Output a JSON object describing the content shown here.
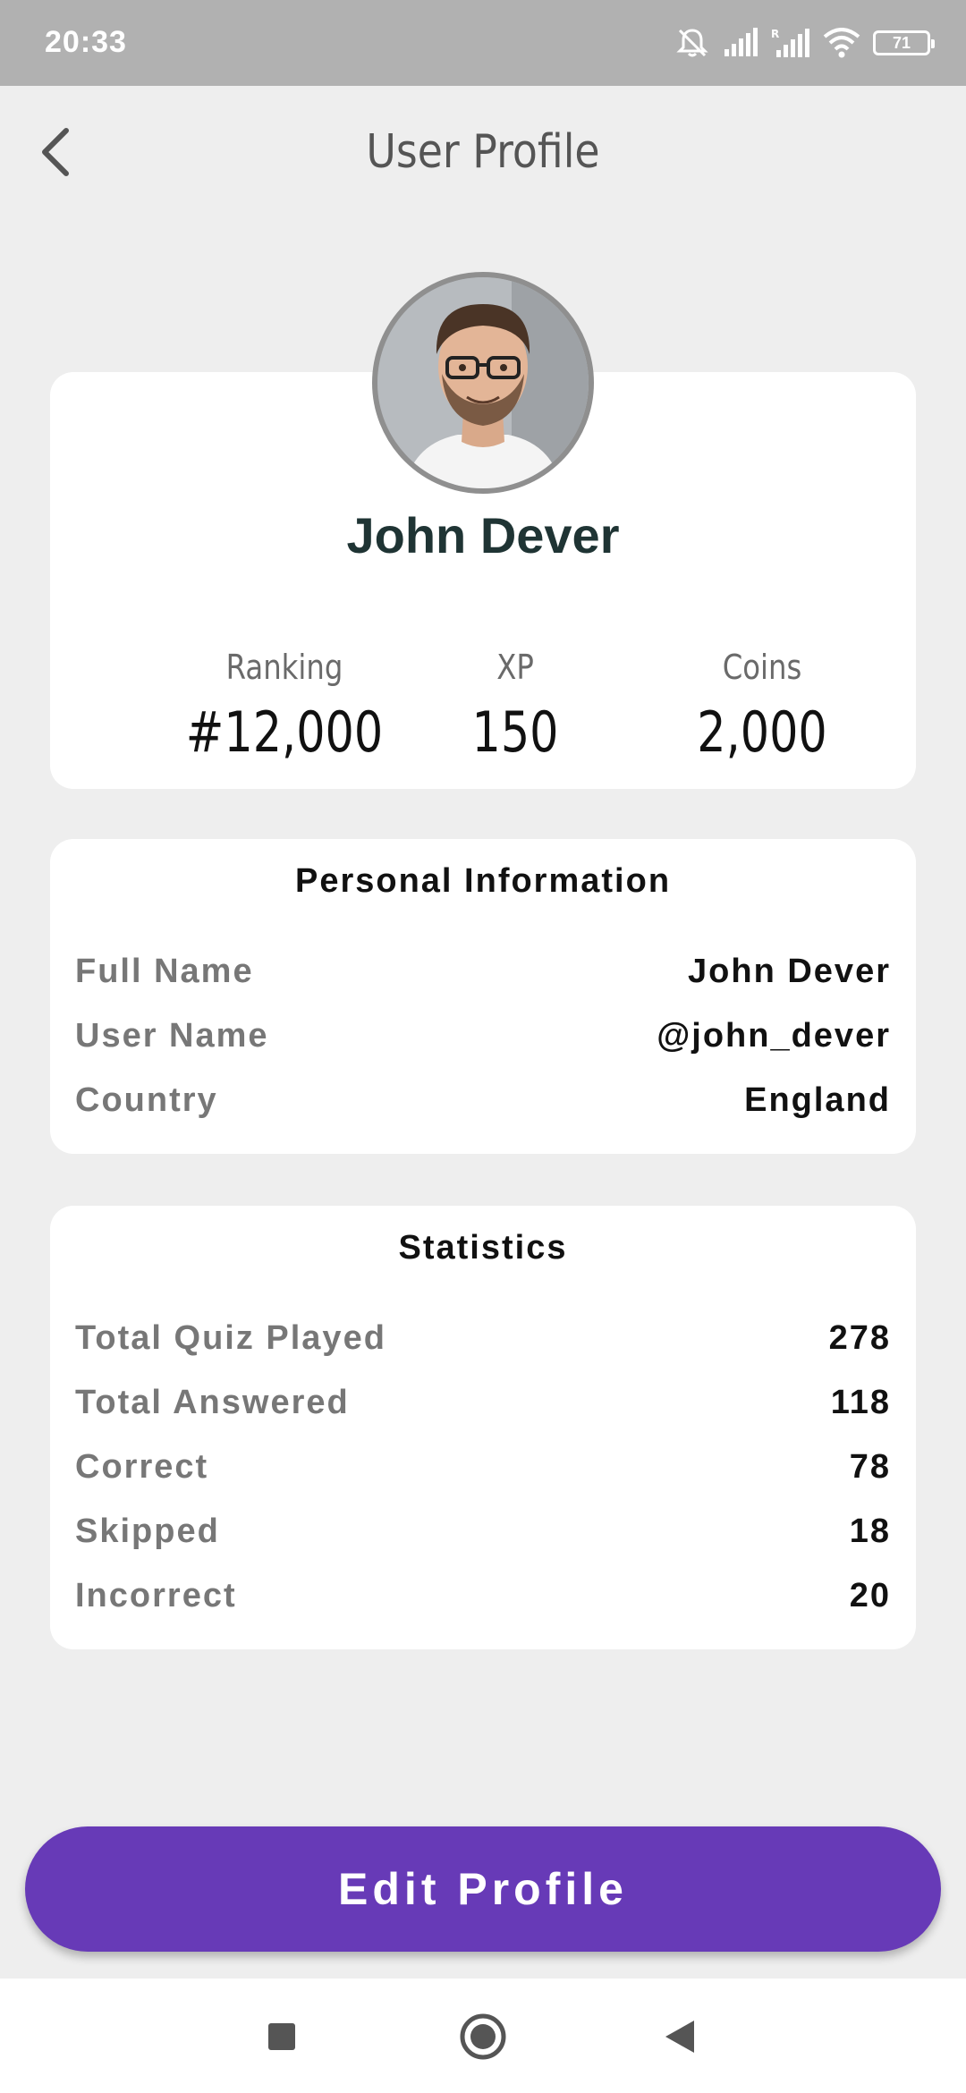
{
  "status_bar": {
    "time": "20:33",
    "battery": "71",
    "icons": [
      "mute-icon",
      "signal-icon",
      "signal-roaming-icon",
      "wifi-icon",
      "battery-icon"
    ]
  },
  "header": {
    "title": "User Profile",
    "back_icon": "chevron-left-icon"
  },
  "profile": {
    "name": "John Dever",
    "stats": [
      {
        "label": "Ranking",
        "value": "#12,000"
      },
      {
        "label": "XP",
        "value": "150"
      },
      {
        "label": "Coins",
        "value": "2,000"
      }
    ]
  },
  "personal_info": {
    "title": "Personal Information",
    "rows": [
      {
        "label": "Full Name",
        "value": "John Dever"
      },
      {
        "label": "User Name",
        "value": "@john_dever"
      },
      {
        "label": "Country",
        "value": "England"
      }
    ]
  },
  "statistics": {
    "title": "Statistics",
    "rows": [
      {
        "label": "Total Quiz Played",
        "value": "278"
      },
      {
        "label": "Total Answered",
        "value": "118"
      },
      {
        "label": "Correct",
        "value": "78"
      },
      {
        "label": "Skipped",
        "value": "18"
      },
      {
        "label": "Incorrect",
        "value": "20"
      }
    ]
  },
  "edit_button": {
    "label": "Edit Profile",
    "color": "#673ab7"
  },
  "nav_bar": {
    "icons": [
      "recents-square-icon",
      "home-circle-icon",
      "back-triangle-icon"
    ]
  }
}
